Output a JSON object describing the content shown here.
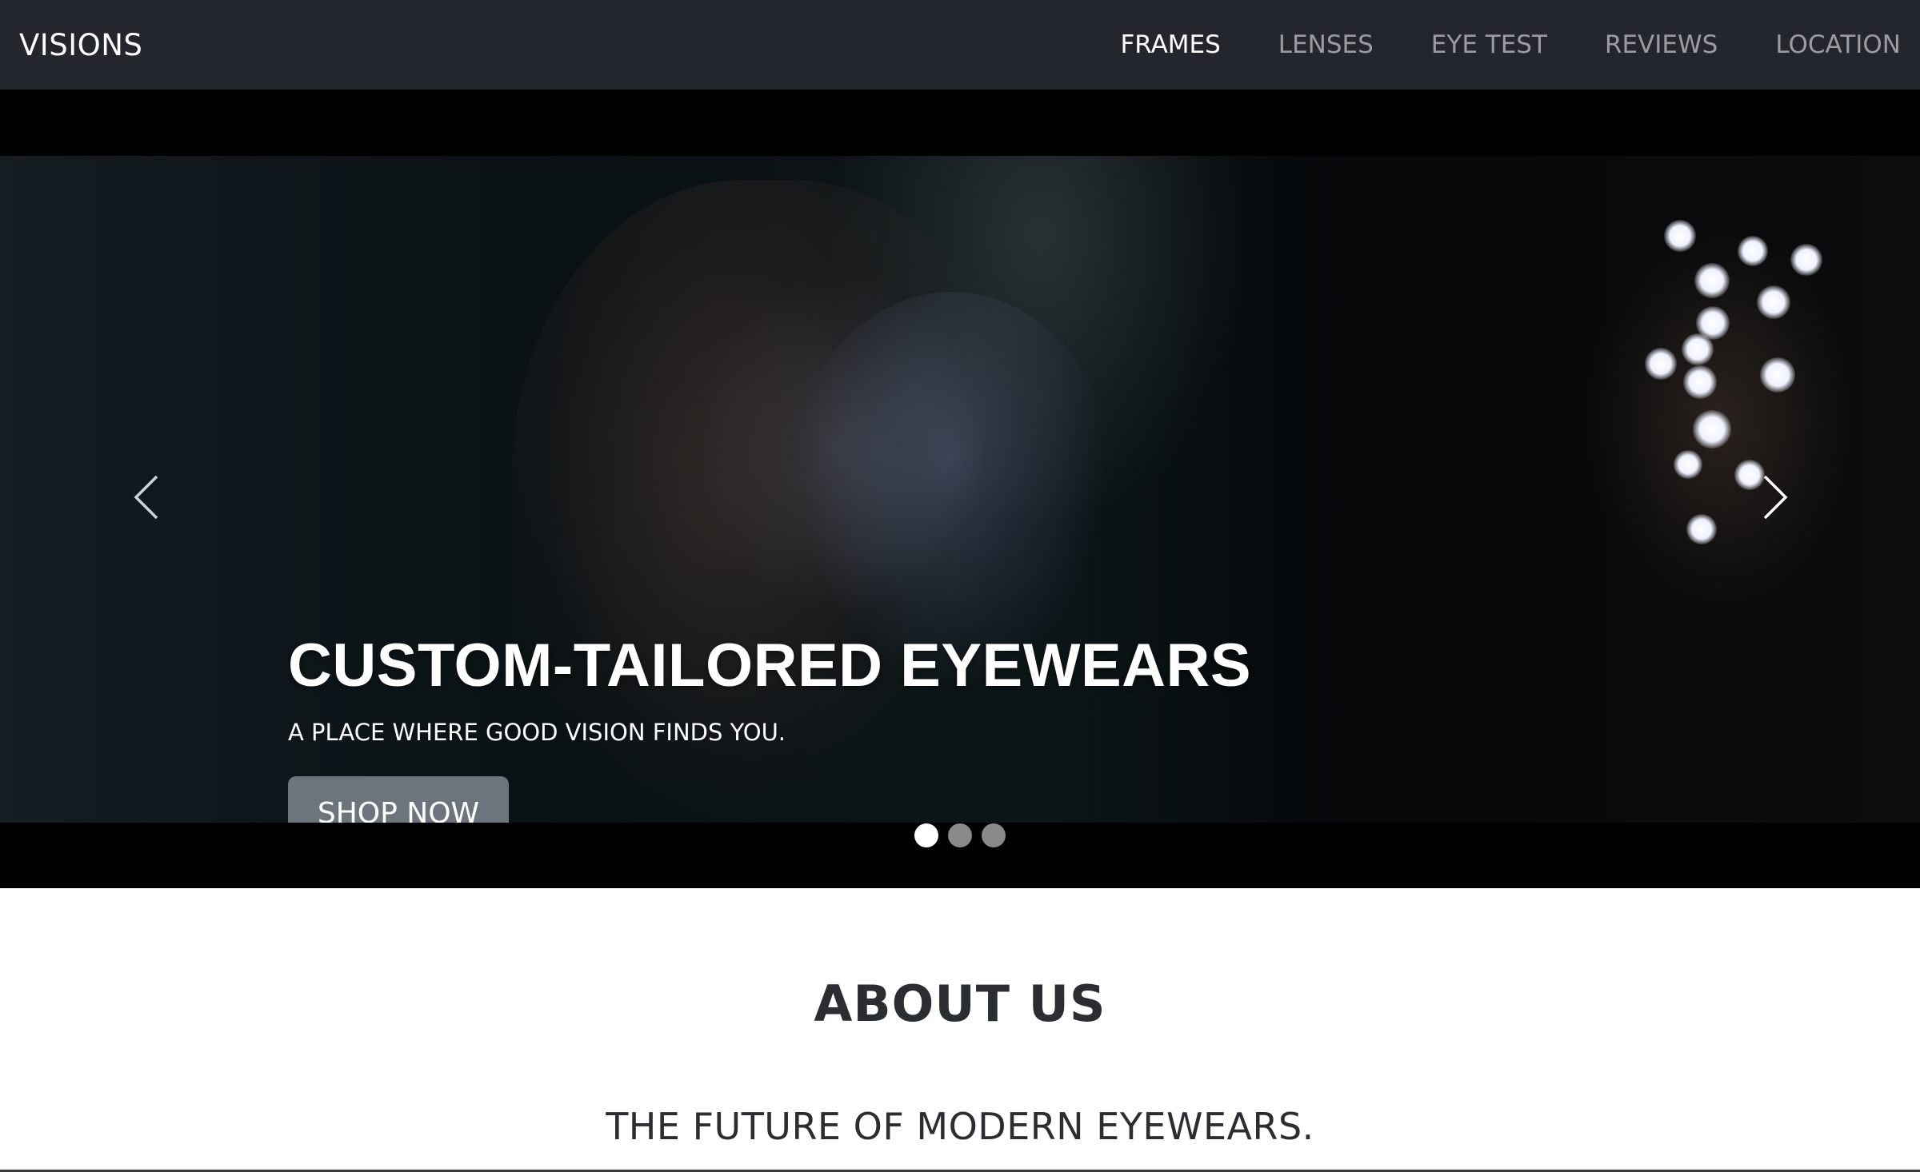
{
  "navbar": {
    "brand": "VISIONS",
    "links": [
      {
        "label": "FRAMES",
        "active": true
      },
      {
        "label": "LENSES",
        "active": false
      },
      {
        "label": "EYE TEST",
        "active": false
      },
      {
        "label": "REVIEWS",
        "active": false
      },
      {
        "label": "LOCATION",
        "active": false
      }
    ]
  },
  "carousel": {
    "caption": {
      "title": "CUSTOM-TAILORED EYEWEARS",
      "subtitle": "A PLACE WHERE GOOD VISION FINDS YOU.",
      "button_label": "SHOP NOW"
    },
    "prev_icon": "chevron-left-icon",
    "next_icon": "chevron-right-icon",
    "slide_count": 3,
    "active_slide": 1
  },
  "about": {
    "title": "ABOUT US",
    "tagline": "THE FUTURE OF MODERN EYEWEARS."
  },
  "colors": {
    "navbar_bg": "#23262d",
    "button_bg": "#6c757d",
    "nav_inactive": "#9a9ca0",
    "nav_active": "#ffffff"
  }
}
